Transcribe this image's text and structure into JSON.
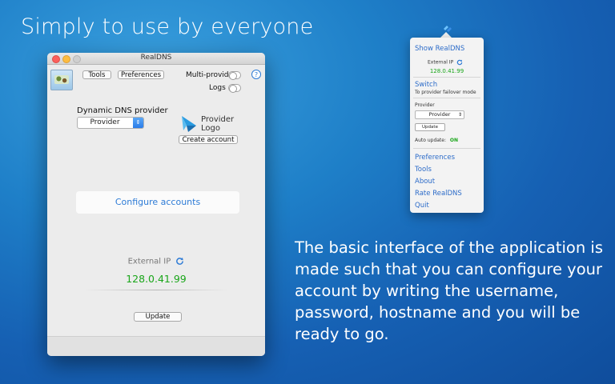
{
  "headline": "Simply to use by everyone",
  "description": "The basic interface of the application is made such that you can configure your account by writing the username, password, hostname and you will be ready to go.",
  "window": {
    "title": "RealDNS",
    "toolbar": {
      "tools_label": "Tools",
      "preferences_label": "Preferences",
      "multi_provider_label": "Multi-provider",
      "logs_label": "Logs",
      "help_label": "?"
    },
    "dns_provider_label": "Dynamic DNS provider",
    "provider_select_value": "Provider",
    "provider_logo_line1": "Provider",
    "provider_logo_line2": "Logo",
    "create_account_label": "Create account",
    "configure_accounts_label": "Configure accounts",
    "external_ip_label": "External IP",
    "ip_value": "128.0.41.99",
    "update_label": "Update"
  },
  "menu": {
    "show_label": "Show RealDNS",
    "external_ip_label": "External IP",
    "ip_value": "128.0.41.99",
    "switch_label": "Switch",
    "switch_sub": "To provider failover mode",
    "provider_label": "Provider",
    "provider_select_value": "Provider",
    "update_label": "Update",
    "auto_update_label": "Auto update:",
    "auto_update_value": "ON",
    "items": [
      "Preferences",
      "Tools",
      "About",
      "Rate RealDNS",
      "Quit"
    ]
  },
  "colors": {
    "accent": "#2d7bd6",
    "ip_green": "#1aa61a",
    "background_blue": "#1e7fc8"
  }
}
